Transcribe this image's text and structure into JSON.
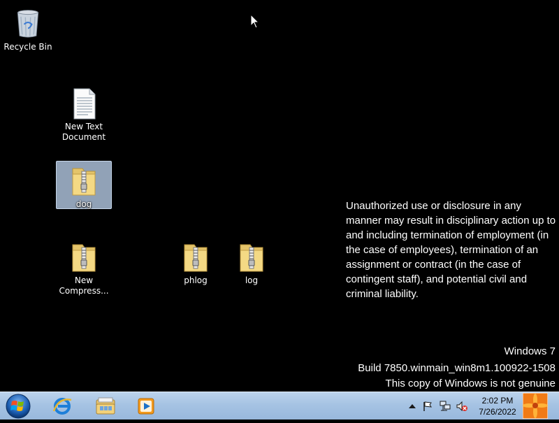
{
  "desktop": {
    "icons": [
      {
        "label": "Recycle Bin"
      },
      {
        "label": "New Text Document"
      },
      {
        "label": "dog"
      },
      {
        "label": "New Compress..."
      },
      {
        "label": "phlog"
      },
      {
        "label": "log"
      }
    ],
    "selected_icon": "dog",
    "notice": "Unauthorized use or disclosure in any manner may result in disciplinary action up to and including termination of employment (in the case of employees), termination of an assignment or contract (in the case of contingent staff), and potential civil and criminal liability.",
    "watermark": {
      "line1": "Windows 7",
      "line2": "Build 7850.winmain_win8m1.100922-1508",
      "line3": "This copy of Windows is not genuine"
    }
  },
  "taskbar": {
    "start_icon": "windows-orb-icon",
    "pinned": [
      "internet-explorer-icon",
      "file-explorer-icon",
      "media-player-icon"
    ],
    "tray_icons": [
      "show-hidden-icons-arrow",
      "action-center-flag-icon",
      "network-icon",
      "volume-muted-icon"
    ],
    "clock": {
      "time": "2:02 PM",
      "date": "7/26/2022"
    },
    "show_desktop_icon": "flower-thumbnail-icon"
  }
}
